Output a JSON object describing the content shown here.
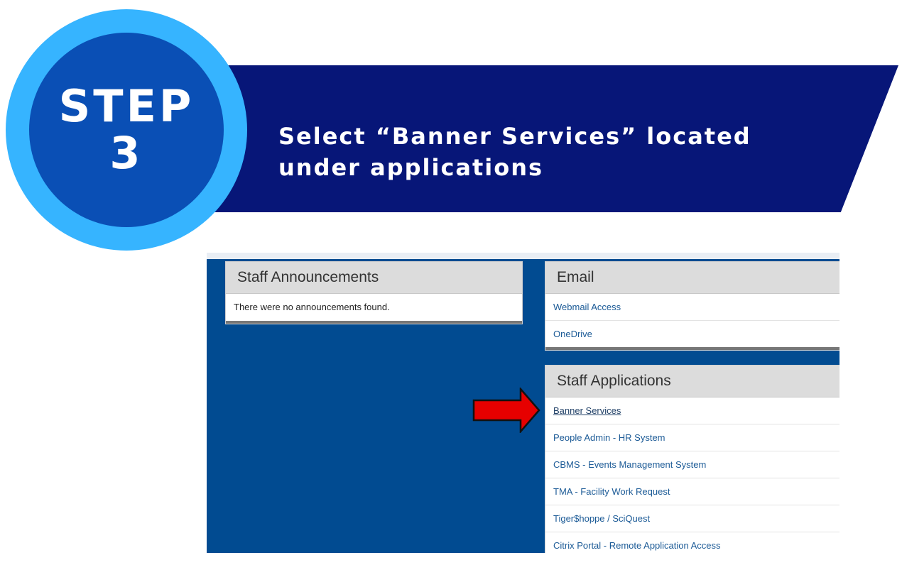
{
  "step": {
    "word": "STEP",
    "number": "3"
  },
  "banner": {
    "instruction": "Select “Banner Services” located under applications"
  },
  "portal": {
    "announcements": {
      "title": "Staff Announcements",
      "message": "There were no announcements found."
    },
    "email": {
      "title": "Email",
      "links": [
        "Webmail Access",
        "OneDrive"
      ]
    },
    "applications": {
      "title": "Staff Applications",
      "links": [
        "Banner Services",
        "People Admin - HR System",
        "CBMS - Events Management System",
        "TMA - Facility Work Request",
        "Tiger$hoppe / SciQuest",
        "Citrix Portal - Remote Application Access"
      ]
    }
  },
  "colors": {
    "banner": "#071678",
    "circle_outer": "#36b4ff",
    "circle_inner": "#0a4fb5",
    "portal_bg": "#014b91",
    "arrow": "#e60000"
  },
  "icons": {
    "pointer": "red-arrow-icon"
  }
}
